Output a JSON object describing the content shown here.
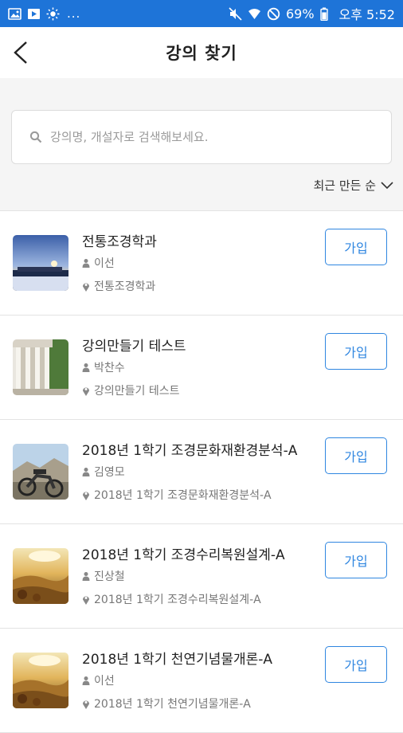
{
  "status_bar": {
    "left_icons": [
      "image-icon",
      "video-play-icon",
      "brightness-icon"
    ],
    "dots": "...",
    "right_icons": [
      "mute-icon",
      "wifi-icon",
      "no-disturb-icon",
      "battery-icon"
    ],
    "battery": "69%",
    "time": "오후 5:52",
    "background": "#1e74d8"
  },
  "header": {
    "back_icon": "chevron-left-icon",
    "title": "강의 찾기"
  },
  "search": {
    "placeholder": "강의명, 개설자로 검색해보세요.",
    "value": "",
    "icon": "search-icon"
  },
  "sort": {
    "label": "최근 만든 순",
    "icon": "chevron-down-icon"
  },
  "accent_color": "#2f86e0",
  "courses": [
    {
      "title": "전통조경학과",
      "professor": "이선",
      "location": "전통조경학과",
      "join_label": "가입",
      "thumb": "dusk-landscape"
    },
    {
      "title": "강의만들기 테스트",
      "professor": "박찬수",
      "location": "강의만들기 테스트",
      "join_label": "가입",
      "thumb": "classical-columns"
    },
    {
      "title": "2018년 1학기 조경문화재환경분석-A",
      "professor": "김영모",
      "location": "2018년 1학기 조경문화재환경분석-A",
      "join_label": "가입",
      "thumb": "motorcycle-mountain"
    },
    {
      "title": "2018년 1학기 조경수리복원설계-A",
      "professor": "진상철",
      "location": "2018년 1학기 조경수리복원설계-A",
      "join_label": "가입",
      "thumb": "golden-field"
    },
    {
      "title": "2018년 1학기 천연기념물개론-A",
      "professor": "이선",
      "location": "2018년 1학기 천연기념물개론-A",
      "join_label": "가입",
      "thumb": "golden-field"
    }
  ]
}
